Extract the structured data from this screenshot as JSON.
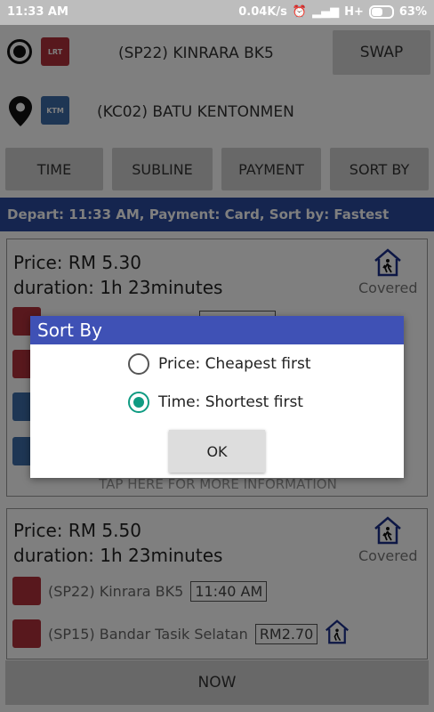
{
  "status_bar": {
    "time": "11:33 AM",
    "speed": "0.04K/s",
    "network": "H+",
    "battery": "63%"
  },
  "route": {
    "origin": "(SP22) KINRARA BK5",
    "destination": "(KC02) BATU KENTONMEN",
    "swap_label": "SWAP",
    "lrt_badge": "LRT",
    "ktm_badge": "KTM"
  },
  "tabs": [
    "TIME",
    "SUBLINE",
    "PAYMENT",
    "SORT BY"
  ],
  "summary": "Depart: 11:33 AM, Payment: Card, Sort by: Fastest",
  "results": [
    {
      "price": "Price: RM 5.30",
      "duration": "duration: 1h 23minutes",
      "covered": "Covered",
      "tap_more": "TAP HERE FOR MORE INFORMATION"
    },
    {
      "price": "Price: RM 5.50",
      "duration": "duration: 1h 23minutes",
      "covered": "Covered",
      "stops": [
        {
          "name": "(SP22) Kinrara BK5",
          "time": "11:40 AM"
        },
        {
          "name": "(SP15) Bandar Tasik Selatan",
          "fare": "RM2.70"
        }
      ]
    }
  ],
  "now_label": "NOW",
  "dialog": {
    "title": "Sort By",
    "options": [
      {
        "label": "Price: Cheapest first",
        "selected": false
      },
      {
        "label": "Time: Shortest first",
        "selected": true
      }
    ],
    "ok_label": "OK"
  },
  "colors": {
    "summary_bar": "#2a4a9e",
    "dialog_title": "#3f51b5",
    "radio_selected": "#0f9b82",
    "lrt": "#b0313a",
    "ktm": "#3c6ca8"
  }
}
